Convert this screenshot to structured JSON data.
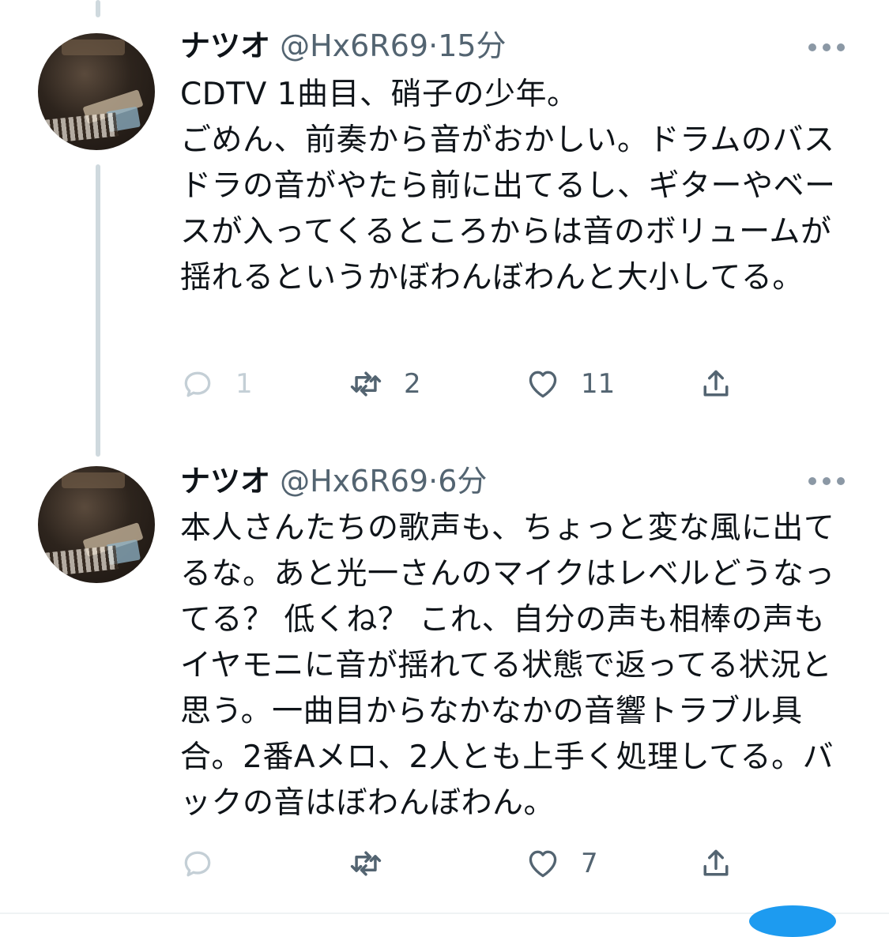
{
  "tweets": [
    {
      "name": "ナツオ",
      "handle": "@Hx6R69",
      "separator": "·",
      "time": "15分",
      "text": "CDTV 1曲目、硝子の少年。\nごめん、前奏から音がおかしい。ドラムのバスドラの音がやたら前に出てるし、ギターやベースが入ってくるところからは音のボリュームが揺れるというかぼわんぼわんと大小してる。",
      "reply_count": "1",
      "retweet_count": "2",
      "like_count": "11"
    },
    {
      "name": "ナツオ",
      "handle": "@Hx6R69",
      "separator": "·",
      "time": "6分",
      "text": "本人さんたちの歌声も、ちょっと変な風に出てるな。あと光一さんのマイクはレベルどうなってる？ 低くね？ これ、自分の声も相棒の声もイヤモニに音が揺れてる状態で返ってる状況と思う。一曲目からなかなかの音響トラブル具合。2番Aメロ、2人とも上手く処理してる。バックの音はぼわんぼわん。",
      "reply_count": "",
      "retweet_count": "",
      "like_count": "7"
    }
  ],
  "icons": {
    "reply": "speech-bubble-icon",
    "retweet": "retweet-icon",
    "like": "heart-icon",
    "share": "share-icon",
    "more": "more-dots-icon"
  },
  "colors": {
    "text": "#0f1419",
    "secondary": "#536471",
    "thread_line": "#cfd9de",
    "accent": "#1d9bf0"
  }
}
